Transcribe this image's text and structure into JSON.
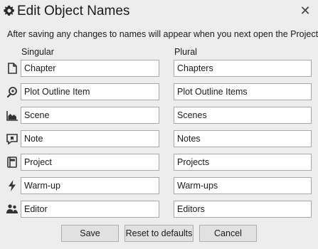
{
  "dialog": {
    "title": "Edit Object Names",
    "title_icon": "gear-icon",
    "close_glyph": "✕",
    "notice": "After saving any changes to names will appear when you next open the Project."
  },
  "columns": {
    "singular": "Singular",
    "plural": "Plural"
  },
  "rows": [
    {
      "icon": "document-icon",
      "singular": "Chapter",
      "plural": "Chapters"
    },
    {
      "icon": "plot-outline-icon",
      "singular": "Plot Outline Item",
      "plural": "Plot Outline Items"
    },
    {
      "icon": "area-chart-icon",
      "singular": "Scene",
      "plural": "Scenes"
    },
    {
      "icon": "note-icon",
      "singular": "Note",
      "plural": "Notes"
    },
    {
      "icon": "project-book-icon",
      "singular": "Project",
      "plural": "Projects"
    },
    {
      "icon": "lightning-icon",
      "singular": "Warm-up",
      "plural": "Warm-ups"
    },
    {
      "icon": "people-icon",
      "singular": "Editor",
      "plural": "Editors"
    }
  ],
  "buttons": {
    "save": "Save",
    "reset": "Reset to defaults",
    "cancel": "Cancel"
  }
}
